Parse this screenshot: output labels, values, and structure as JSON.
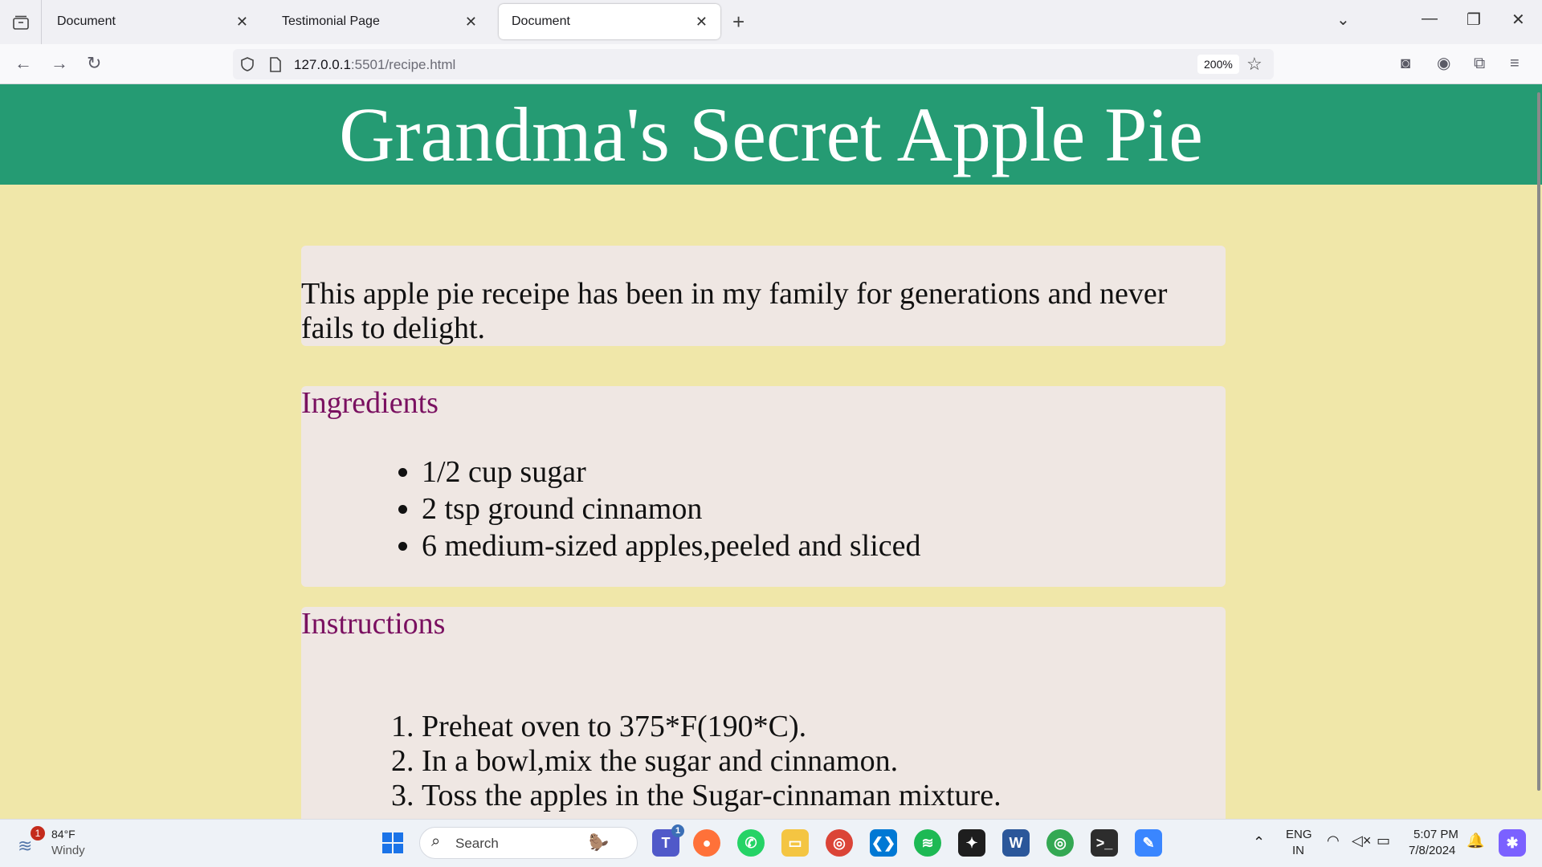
{
  "browser": {
    "tabs": [
      {
        "title": "Document",
        "active": false
      },
      {
        "title": "Testimonial Page",
        "active": false
      },
      {
        "title": "Document",
        "active": true
      }
    ],
    "url_host": "127.0.0.1",
    "url_rest": ":5501/recipe.html",
    "zoom": "200%"
  },
  "page": {
    "title": "Grandma's Secret Apple Pie",
    "intro": "This apple pie receipe has been in my family for generations and never fails to delight.",
    "ingredients": {
      "heading": "Ingredients",
      "items": [
        "1/2 cup sugar",
        "2 tsp ground cinnamon",
        "6 medium-sized apples,peeled and sliced"
      ]
    },
    "instructions": {
      "heading": "Instructions",
      "steps": [
        "Preheat oven to 375*F(190*C).",
        "In a bowl,mix the sugar and cinnamon.",
        "Toss the apples in the Sugar-cinnaman mixture."
      ]
    }
  },
  "taskbar": {
    "weather_temp": "84°F",
    "weather_desc": "Windy",
    "weather_badge": "1",
    "search_label": "Search",
    "teams_badge": "1",
    "lang_line1": "ENG",
    "lang_line2": "IN",
    "time": "5:07 PM",
    "date": "7/8/2024",
    "colors": {
      "accent_green": "#259b73",
      "heading_purple": "#7a1060",
      "page_bg": "#f0e7a9"
    }
  }
}
